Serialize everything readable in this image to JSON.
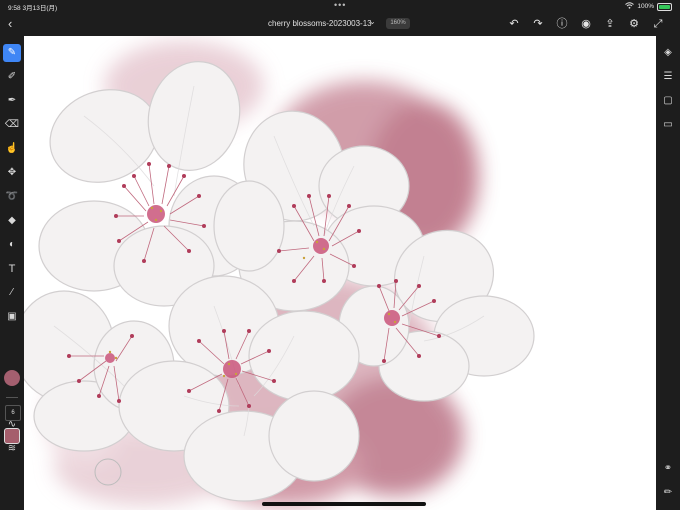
{
  "status": {
    "time": "9:58",
    "date": "3月13日(月)",
    "battery": "100%"
  },
  "header": {
    "title": "cherry blossoms-2023003-13",
    "zoom": "160%",
    "icons": [
      "back-icon",
      "undo-icon",
      "redo-icon",
      "help-icon",
      "account-icon",
      "share-icon",
      "settings-icon",
      "fullscreen-icon"
    ]
  },
  "left_tools": [
    "paint-brush-icon",
    "pixel-brush-icon",
    "vector-brush-icon",
    "eraser-icon",
    "smudge-icon",
    "transform-icon",
    "lasso-select-icon",
    "fill-icon",
    "shape-icon",
    "text-icon",
    "eyedropper-icon",
    "image-icon"
  ],
  "brush": {
    "size": "6",
    "color": "#a55e6c"
  },
  "right_tools": [
    "layers-icon",
    "layer-properties-icon",
    "artboard-icon",
    "comments-icon",
    "layer-adjust-icon",
    "pencil-icon"
  ]
}
